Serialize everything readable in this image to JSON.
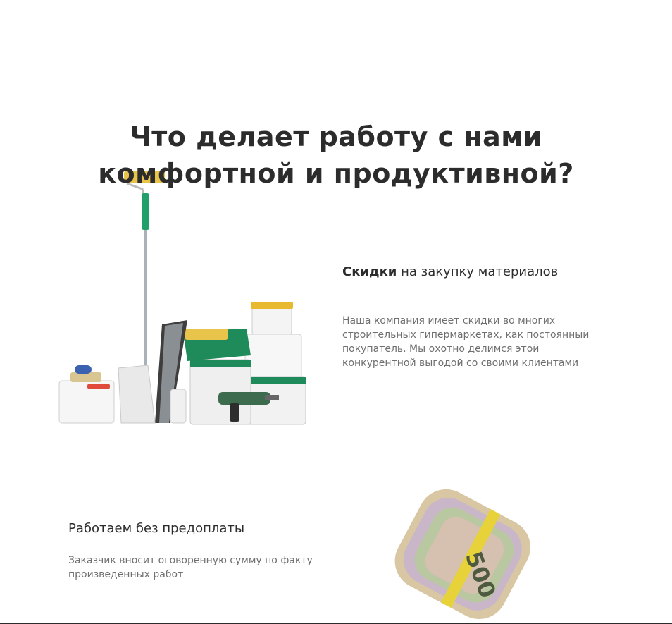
{
  "heading": {
    "line1": "Что делает работу с нами",
    "line2": "комфортной и продуктивной?"
  },
  "features": [
    {
      "title_bold": "Скидки",
      "title_rest": " на закупку материалов",
      "text_lines": [
        "Наша компания имеет скидки во многих",
        "строительных гипермаркетах, как постоянный",
        "покупатель. Мы охотно делимся этой",
        "конкурентной выгодой со своими клиентами"
      ]
    },
    {
      "title": "Работаем без предоплаты",
      "text_lines": [
        "Заказчик вносит оговоренную сумму по факту",
        "произведенных работ"
      ]
    }
  ],
  "money_label": "500",
  "colors": {
    "heading": "#2c2c2c",
    "body_text": "#6f6f6f",
    "accent_green": "#1f8a5a",
    "roller_yellow": "#e8c44a",
    "divider": "#d9d9d9"
  }
}
